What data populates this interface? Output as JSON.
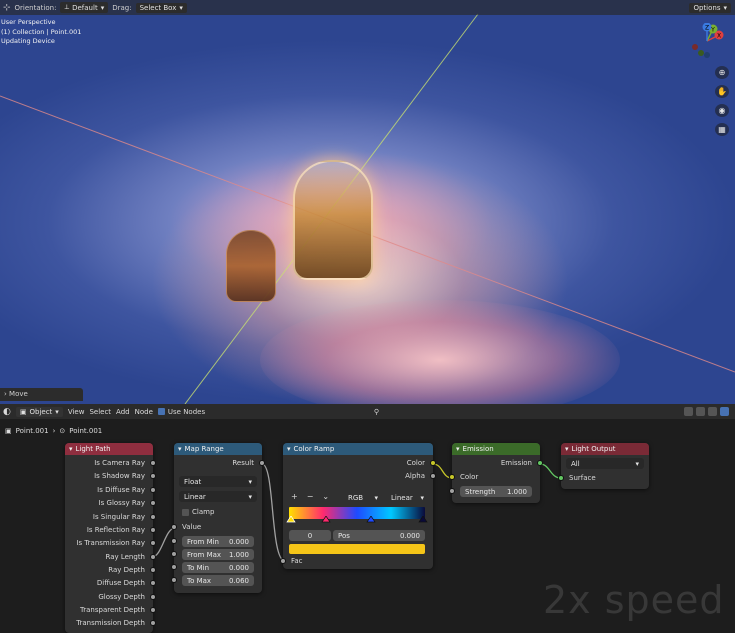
{
  "viewport_header": {
    "orientation_label": "Orientation:",
    "orientation_value": "Default",
    "drag_label": "Drag:",
    "drag_value": "Select Box",
    "options_label": "Options"
  },
  "viewport_info": {
    "line1": "User Perspective",
    "line2": "(1) Collection | Point.001",
    "line3": "Updating Device"
  },
  "gizmo": {
    "x": "X",
    "y": "Y",
    "z": "Z"
  },
  "last_operator": "Move",
  "node_header": {
    "mode": "Object",
    "menus": [
      "View",
      "Select",
      "Add",
      "Node"
    ],
    "use_nodes_label": "Use Nodes"
  },
  "breadcrumb": {
    "object": "Point.001"
  },
  "nodes": {
    "light_path": {
      "title": "Light Path",
      "outputs": [
        "Is Camera Ray",
        "Is Shadow Ray",
        "Is Diffuse Ray",
        "Is Glossy Ray",
        "Is Singular Ray",
        "Is Reflection Ray",
        "Is Transmission Ray",
        "Ray Length",
        "Ray Depth",
        "Diffuse Depth",
        "Glossy Depth",
        "Transparent Depth",
        "Transmission Depth"
      ]
    },
    "map_range": {
      "title": "Map Range",
      "output": "Result",
      "data_type": "Float",
      "interpolation": "Linear",
      "clamp_label": "Clamp",
      "value_label": "Value",
      "from_min_label": "From Min",
      "from_min": "0.000",
      "from_max_label": "From Max",
      "from_max": "1.000",
      "to_min_label": "To Min",
      "to_min": "0.000",
      "to_max_label": "To Max",
      "to_max": "0.060"
    },
    "color_ramp": {
      "title": "Color Ramp",
      "out_color": "Color",
      "out_alpha": "Alpha",
      "color_mode": "RGB",
      "interpolation": "Linear",
      "stop_index": "0",
      "pos_label": "Pos",
      "pos_value": "0.000",
      "fac_label": "Fac",
      "selected_color": "#f5c518",
      "stops": [
        "#ffe000",
        "#ff2a6e",
        "#1e4bff",
        "#00c8ff",
        "#0a0a3a"
      ]
    },
    "emission": {
      "title": "Emission",
      "output": "Emission",
      "color_label": "Color",
      "strength_label": "Strength",
      "strength": "1.000"
    },
    "light_output": {
      "title": "Light Output",
      "target": "All",
      "surface_label": "Surface"
    }
  },
  "watermark": "2x speed",
  "colors": {
    "light_path_header": "#8f2e3f",
    "map_range_header": "#2d5a7a",
    "color_ramp_header": "#2d5a7a",
    "emission_header": "#3b6b29",
    "light_output_header": "#7a2a36"
  }
}
